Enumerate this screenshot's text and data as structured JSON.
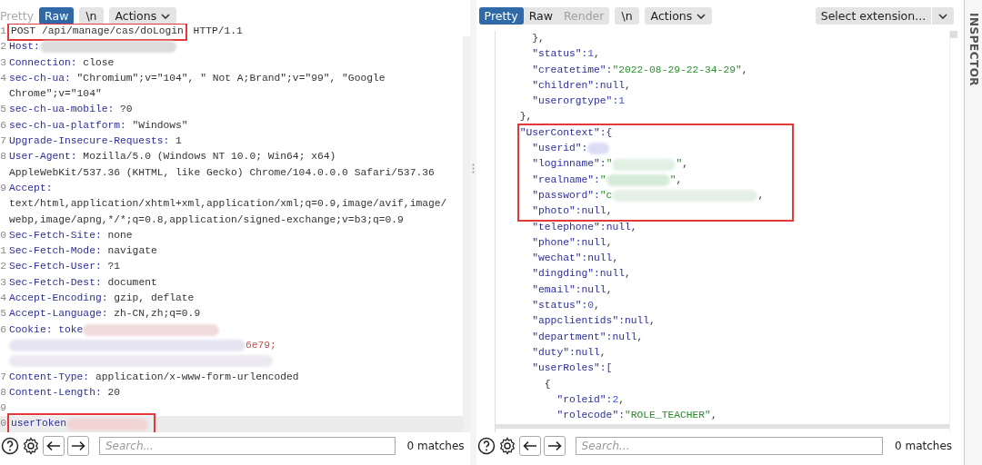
{
  "request": {
    "tabs": [
      {
        "label": "Pretty",
        "selected": false
      },
      {
        "label": "Raw",
        "selected": true
      }
    ],
    "wrap_button": "\\n",
    "actions_button": "Actions",
    "rows": [
      {
        "num": "1",
        "segs": [
          {
            "kind": "box",
            "segs": [
              {
                "kind": "plain",
                "text": "POST /api/manage/cas/doLogin"
              }
            ]
          },
          {
            "kind": "plain",
            "text": " HTTP/1.1"
          }
        ]
      },
      {
        "num": "2",
        "segs": [
          {
            "kind": "key",
            "text": "Host:"
          },
          {
            "kind": "redacted",
            "color": "#dcdcdc"
          }
        ]
      },
      {
        "num": "3",
        "segs": [
          {
            "kind": "key",
            "text": "Connection:"
          },
          {
            "kind": "plain",
            "text": " close"
          }
        ]
      },
      {
        "num": "4",
        "segs": [
          {
            "kind": "key",
            "text": "sec-ch-ua:"
          },
          {
            "kind": "plain",
            "text": " \"Chromium\";v=\"104\", \" Not A;Brand\";v=\"99\", \"Google"
          }
        ]
      },
      {
        "segs": [
          {
            "kind": "plain",
            "text": "Chrome\";v=\"104\""
          }
        ]
      },
      {
        "num": "5",
        "segs": [
          {
            "kind": "key",
            "text": "sec-ch-ua-mobile:"
          },
          {
            "kind": "plain",
            "text": " ?0"
          }
        ]
      },
      {
        "num": "6",
        "segs": [
          {
            "kind": "key",
            "text": "sec-ch-ua-platform:"
          },
          {
            "kind": "plain",
            "text": " \"Windows\""
          }
        ]
      },
      {
        "num": "7",
        "segs": [
          {
            "kind": "key",
            "text": "Upgrade-Insecure-Requests:"
          },
          {
            "kind": "plain",
            "text": " 1"
          }
        ]
      },
      {
        "num": "8",
        "segs": [
          {
            "kind": "key",
            "text": "User-Agent:"
          },
          {
            "kind": "plain",
            "text": " Mozilla/5.0 (Windows NT 10.0; Win64; x64)"
          }
        ]
      },
      {
        "segs": [
          {
            "kind": "plain",
            "text": "AppleWebKit/537.36 (KHTML, like Gecko) Chrome/104.0.0.0 Safari/537.36"
          }
        ]
      },
      {
        "num": "9",
        "segs": [
          {
            "kind": "key",
            "text": "Accept:"
          }
        ]
      },
      {
        "segs": [
          {
            "kind": "plain",
            "text": "text/html,application/xhtml+xml,application/xml;q=0.9,image/avif,image/"
          }
        ]
      },
      {
        "segs": [
          {
            "kind": "plain",
            "text": "webp,image/apng,*/*;q=0.8,application/signed-exchange;v=b3;q=0.9"
          }
        ]
      },
      {
        "num": "0",
        "segs": [
          {
            "kind": "key",
            "text": "Sec-Fetch-Site:"
          },
          {
            "kind": "plain",
            "text": " none"
          }
        ]
      },
      {
        "num": "1",
        "segs": [
          {
            "kind": "key",
            "text": "Sec-Fetch-Mode:"
          },
          {
            "kind": "plain",
            "text": " navigate"
          }
        ]
      },
      {
        "num": "2",
        "segs": [
          {
            "kind": "key",
            "text": "Sec-Fetch-User:"
          },
          {
            "kind": "plain",
            "text": " ?1"
          }
        ]
      },
      {
        "num": "3",
        "segs": [
          {
            "kind": "key",
            "text": "Sec-Fetch-Dest:"
          },
          {
            "kind": "plain",
            "text": " document"
          }
        ]
      },
      {
        "num": "4",
        "segs": [
          {
            "kind": "key",
            "text": "Accept-Encoding:"
          },
          {
            "kind": "plain",
            "text": " gzip, deflate"
          }
        ]
      },
      {
        "num": "5",
        "segs": [
          {
            "kind": "key",
            "text": "Accept-Language:"
          },
          {
            "kind": "plain",
            "text": " zh-CN,zh;q=0.9"
          }
        ]
      },
      {
        "num": "6",
        "segs": [
          {
            "kind": "key",
            "text": "Cookie: toke"
          },
          {
            "kind": "redacted",
            "color": "#f0dada"
          }
        ]
      },
      {
        "segs": [
          {
            "kind": "redacted",
            "color": "#e6e4f2"
          },
          {
            "kind": "cookie",
            "text": "6e79;"
          }
        ]
      },
      {
        "segs": [
          {
            "kind": "redacted",
            "color": "#ece8f0"
          }
        ]
      },
      {
        "num": "7",
        "segs": [
          {
            "kind": "key",
            "text": "Content-Type:"
          },
          {
            "kind": "plain",
            "text": " application/x-www-form-urlencoded"
          }
        ]
      },
      {
        "num": "8",
        "segs": [
          {
            "kind": "key",
            "text": "Content-Length:"
          },
          {
            "kind": "plain",
            "text": " 20"
          }
        ]
      },
      {
        "num": "9",
        "segs": []
      },
      {
        "num": "0",
        "highlighted": true,
        "segs": [
          {
            "kind": "box",
            "segs": [
              {
                "kind": "key",
                "text": "userToken"
              },
              {
                "kind": "redacted",
                "color": "#f2d4d4"
              }
            ]
          }
        ]
      }
    ],
    "search": {
      "placeholder": "Search..."
    },
    "matches": "0 matches"
  },
  "response": {
    "tabs": [
      {
        "label": "Pretty",
        "selected": true,
        "disabled": false
      },
      {
        "label": "Raw",
        "selected": false,
        "disabled": false
      },
      {
        "label": "Render",
        "selected": false,
        "disabled": true
      }
    ],
    "wrap_button": "\\n",
    "actions_button": "Actions",
    "extension_select": "Select extension...",
    "rows": [
      {
        "indent": "      ",
        "segs": [
          {
            "kind": "plain",
            "text": "},"
          }
        ]
      },
      {
        "indent": "      ",
        "segs": [
          {
            "kind": "key",
            "text": "\"status\":"
          },
          {
            "kind": "number",
            "text": "1"
          },
          {
            "kind": "plain",
            "text": ","
          }
        ]
      },
      {
        "indent": "      ",
        "segs": [
          {
            "kind": "key",
            "text": "\"createtime\":"
          },
          {
            "kind": "string",
            "text": "\"2022-08-29-22-34-29\""
          },
          {
            "kind": "plain",
            "text": ","
          }
        ]
      },
      {
        "indent": "      ",
        "segs": [
          {
            "kind": "key",
            "text": "\"children\":"
          },
          {
            "kind": "literal",
            "text": "null"
          },
          {
            "kind": "plain",
            "text": ","
          }
        ]
      },
      {
        "indent": "      ",
        "segs": [
          {
            "kind": "key",
            "text": "\"userorgtype\":"
          },
          {
            "kind": "number",
            "text": "1"
          }
        ]
      },
      {
        "indent": "    ",
        "segs": [
          {
            "kind": "plain",
            "text": "},"
          }
        ]
      },
      {
        "kind": "group",
        "boxed": true,
        "rows": [
          {
            "indent": "    ",
            "segs": [
              {
                "kind": "key",
                "text": "\"UserContext\":{"
              }
            ]
          },
          {
            "indent": "      ",
            "segs": [
              {
                "kind": "key",
                "text": "\"userid\":"
              },
              {
                "kind": "redacted",
                "color": "#dcdcf6"
              }
            ]
          },
          {
            "indent": "      ",
            "segs": [
              {
                "kind": "key",
                "text": "\"loginname\":"
              },
              {
                "kind": "string",
                "text": "\""
              },
              {
                "kind": "redacted",
                "color": "#e2f0e4"
              },
              {
                "kind": "string",
                "text": "\""
              },
              {
                "kind": "plain",
                "text": ","
              }
            ]
          },
          {
            "indent": "      ",
            "segs": [
              {
                "kind": "key",
                "text": "\"realname\":"
              },
              {
                "kind": "string",
                "text": "\""
              },
              {
                "kind": "redacted",
                "color": "#d6ecd8"
              },
              {
                "kind": "string",
                "text": "\""
              },
              {
                "kind": "plain",
                "text": ","
              }
            ]
          },
          {
            "indent": "      ",
            "segs": [
              {
                "kind": "key",
                "text": "\"password\":"
              },
              {
                "kind": "string",
                "text": "\"c"
              },
              {
                "kind": "redacted",
                "color": "#e4f0e6"
              },
              {
                "kind": "plain",
                "text": ","
              }
            ]
          },
          {
            "indent": "      ",
            "segs": [
              {
                "kind": "key",
                "text": "\"photo\":"
              },
              {
                "kind": "literal",
                "text": "null"
              },
              {
                "kind": "plain",
                "text": ","
              }
            ]
          }
        ]
      },
      {
        "indent": "      ",
        "segs": [
          {
            "kind": "key",
            "text": "\"telephone\":"
          },
          {
            "kind": "literal",
            "text": "null"
          },
          {
            "kind": "plain",
            "text": ","
          }
        ]
      },
      {
        "indent": "      ",
        "segs": [
          {
            "kind": "key",
            "text": "\"phone\":"
          },
          {
            "kind": "literal",
            "text": "null"
          },
          {
            "kind": "plain",
            "text": ","
          }
        ]
      },
      {
        "indent": "      ",
        "segs": [
          {
            "kind": "key",
            "text": "\"wechat\":"
          },
          {
            "kind": "literal",
            "text": "null"
          },
          {
            "kind": "plain",
            "text": ","
          }
        ]
      },
      {
        "indent": "      ",
        "segs": [
          {
            "kind": "key",
            "text": "\"dingding\":"
          },
          {
            "kind": "literal",
            "text": "null"
          },
          {
            "kind": "plain",
            "text": ","
          }
        ]
      },
      {
        "indent": "      ",
        "segs": [
          {
            "kind": "key",
            "text": "\"email\":"
          },
          {
            "kind": "literal",
            "text": "null"
          },
          {
            "kind": "plain",
            "text": ","
          }
        ]
      },
      {
        "indent": "      ",
        "segs": [
          {
            "kind": "key",
            "text": "\"status\":"
          },
          {
            "kind": "number",
            "text": "0"
          },
          {
            "kind": "plain",
            "text": ","
          }
        ]
      },
      {
        "indent": "      ",
        "segs": [
          {
            "kind": "key",
            "text": "\"appclientids\":"
          },
          {
            "kind": "literal",
            "text": "null"
          },
          {
            "kind": "plain",
            "text": ","
          }
        ]
      },
      {
        "indent": "      ",
        "segs": [
          {
            "kind": "key",
            "text": "\"department\":"
          },
          {
            "kind": "literal",
            "text": "null"
          },
          {
            "kind": "plain",
            "text": ","
          }
        ]
      },
      {
        "indent": "      ",
        "segs": [
          {
            "kind": "key",
            "text": "\"duty\":"
          },
          {
            "kind": "literal",
            "text": "null"
          },
          {
            "kind": "plain",
            "text": ","
          }
        ]
      },
      {
        "indent": "      ",
        "segs": [
          {
            "kind": "key",
            "text": "\"userRoles\":["
          }
        ]
      },
      {
        "indent": "        ",
        "segs": [
          {
            "kind": "plain",
            "text": "{"
          }
        ]
      },
      {
        "indent": "          ",
        "segs": [
          {
            "kind": "key",
            "text": "\"roleid\":"
          },
          {
            "kind": "number",
            "text": "2"
          },
          {
            "kind": "plain",
            "text": ","
          }
        ]
      },
      {
        "indent": "          ",
        "segs": [
          {
            "kind": "key",
            "text": "\"rolecode\":"
          },
          {
            "kind": "string",
            "text": "\"ROLE_TEACHER\""
          },
          {
            "kind": "plain",
            "text": ","
          }
        ]
      }
    ],
    "search": {
      "placeholder": "Search..."
    },
    "matches": "0 matches"
  },
  "inspector": {
    "label": "INSPECTOR"
  }
}
